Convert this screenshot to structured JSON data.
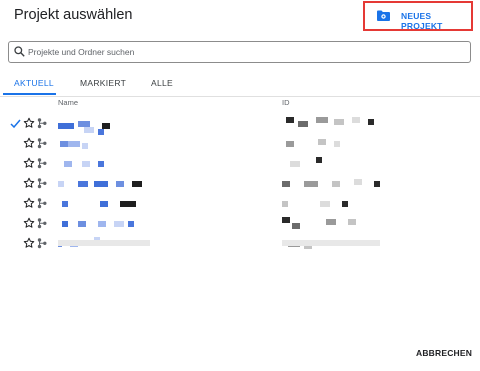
{
  "dialog": {
    "title": "Projekt auswählen",
    "new_project_label": "NEUES PROJEKT",
    "cancel_label": "ABBRECHEN"
  },
  "search": {
    "placeholder": "Projekte und Ordner suchen",
    "value": ""
  },
  "tabs": [
    {
      "label": "AKTUELL",
      "active": true
    },
    {
      "label": "MARKIERT",
      "active": false
    },
    {
      "label": "ALLE",
      "active": false
    }
  ],
  "table": {
    "columns": [
      "Name",
      "ID"
    ],
    "rows": [
      {
        "selected": true,
        "starred": false
      },
      {
        "selected": false,
        "starred": false
      },
      {
        "selected": false,
        "starred": false
      },
      {
        "selected": false,
        "starred": false
      },
      {
        "selected": false,
        "starred": false
      },
      {
        "selected": false,
        "starred": false
      },
      {
        "selected": false,
        "starred": false
      }
    ]
  },
  "colors": {
    "accent": "#1a73e8",
    "highlight_border": "#e53935",
    "text": "#202124"
  },
  "icons": [
    "folder-settings-icon",
    "search-icon",
    "check-icon",
    "star-outline-icon",
    "organization-icon"
  ]
}
